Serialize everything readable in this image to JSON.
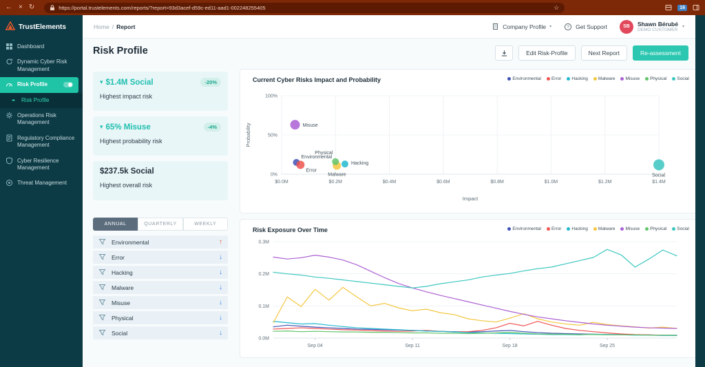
{
  "browser": {
    "url": "https://portal.trustelements.com/reports/?report=93d3acef-d59c-ed11-aad1-002248255405",
    "badge_count": "16"
  },
  "icons": {
    "back": "←",
    "close": "×",
    "refresh": "↻",
    "star": "☆",
    "caret_down": "▾",
    "chevron_down": "▾",
    "trend_up": "↑",
    "trend_down": "↓",
    "breadcrumb_separator": "/"
  },
  "brand": {
    "name": "TrustElements"
  },
  "sidebar": {
    "items": [
      {
        "icon": "dashboard",
        "label": "Dashboard"
      },
      {
        "icon": "cycle",
        "label": "Dynamic Cyber Risk Management"
      },
      {
        "icon": "gauge",
        "label": "Risk Profile",
        "active": true
      },
      {
        "icon": "dot",
        "label": "Risk Profile",
        "sub": true
      },
      {
        "icon": "gear",
        "label": "Operations Risk Management"
      },
      {
        "icon": "doc",
        "label": "Regulatory Compliance Management"
      },
      {
        "icon": "shield",
        "label": "Cyber Resilience Management"
      },
      {
        "icon": "target",
        "label": "Threat Management"
      }
    ]
  },
  "topbar": {
    "breadcrumb": {
      "home": "Home",
      "current": "Report"
    },
    "company_profile": "Company Profile",
    "get_support": "Get Support",
    "user": {
      "initials": "SB",
      "name": "Shawn Bérubé",
      "role": "DEMO CUSTOMER"
    }
  },
  "page": {
    "title": "Risk Profile",
    "buttons": {
      "edit": "Edit Risk-Profile",
      "next": "Next Report",
      "reassess": "Re-assessment"
    }
  },
  "summary_cards": [
    {
      "value": "$1.4M Social",
      "badge": "-20%",
      "caption": "Highest impact risk",
      "style": "accent",
      "caret": true
    },
    {
      "value": "65% Misuse",
      "badge": "-4%",
      "caption": "Highest probability risk",
      "style": "accent",
      "caret": true
    },
    {
      "value": "$237.5k Social",
      "caption": "Highest overall risk",
      "style": "dark",
      "caret": false
    }
  ],
  "tabs": [
    {
      "label": "ANNUAL",
      "active": true
    },
    {
      "label": "QUARTERLY",
      "active": false
    },
    {
      "label": "WEEKLY",
      "active": false
    }
  ],
  "risk_list": [
    {
      "name": "Environmental",
      "trend": "up"
    },
    {
      "name": "Error",
      "trend": "down"
    },
    {
      "name": "Hacking",
      "trend": "down"
    },
    {
      "name": "Malware",
      "trend": "down"
    },
    {
      "name": "Misuse",
      "trend": "down"
    },
    {
      "name": "Physical",
      "trend": "down"
    },
    {
      "name": "Social",
      "trend": "down"
    }
  ],
  "categories": [
    {
      "name": "Environmental",
      "color": "#3f51b5"
    },
    {
      "name": "Error",
      "color": "#ef5350"
    },
    {
      "name": "Hacking",
      "color": "#22b8cf"
    },
    {
      "name": "Malware",
      "color": "#f4c63e"
    },
    {
      "name": "Misuse",
      "color": "#ab5fd3"
    },
    {
      "name": "Physical",
      "color": "#61c46a"
    },
    {
      "name": "Social",
      "color": "#3ac6bf"
    }
  ],
  "colors": {
    "accent_teal": "#1fbfae",
    "primary_button": "#2bc7b0",
    "active_nav": "#1fc3a6",
    "sidebar_bg": "#0c3a45",
    "browser_bar": "#7d2807",
    "avatar_bg": "#e2485b",
    "trend_up": "#e0503c",
    "trend_down": "#2f7fe8",
    "tab_active_bg": "#5b6d7d",
    "badge_bg": "#d2efe9",
    "badge_text": "#18a68e"
  },
  "chart_data": [
    {
      "type": "scatter",
      "title": "Current Cyber Risks Impact and Probability",
      "xlabel": "Impact",
      "ylabel": "Probability",
      "xlim": [
        0,
        1.4
      ],
      "ylim": [
        0,
        100
      ],
      "x_tick_labels": [
        "$0.0M",
        "$0.2M",
        "$0.4M",
        "$0.6M",
        "$0.8M",
        "$1.0M",
        "$1.2M",
        "$1.4M"
      ],
      "y_tick_labels": [
        "0%",
        "50%",
        "100%"
      ],
      "legend_position": "top-right",
      "points": [
        {
          "name": "Environmental",
          "impact_m": 0.055,
          "probability_pct": 15,
          "r": 5
        },
        {
          "name": "Error",
          "impact_m": 0.07,
          "probability_pct": 12,
          "r": 6
        },
        {
          "name": "Hacking",
          "impact_m": 0.235,
          "probability_pct": 13,
          "r": 5
        },
        {
          "name": "Malware",
          "impact_m": 0.205,
          "probability_pct": 11,
          "r": 6
        },
        {
          "name": "Misuse",
          "impact_m": 0.05,
          "probability_pct": 63,
          "r": 7
        },
        {
          "name": "Physical",
          "impact_m": 0.2,
          "probability_pct": 16,
          "r": 5
        },
        {
          "name": "Social",
          "impact_m": 1.4,
          "probability_pct": 12,
          "r": 8
        }
      ]
    },
    {
      "type": "line",
      "title": "Risk Exposure Over Time",
      "xlabel": "",
      "ylabel": "",
      "ylim": [
        0,
        0.3
      ],
      "y_tick_labels": [
        "0.0M",
        "0.1M",
        "0.2M",
        "0.3M"
      ],
      "x_tick_labels": [
        "Sep 04",
        "Sep 11",
        "Sep 18",
        "Sep 25"
      ],
      "legend_position": "top-right",
      "x": [
        "Sep 01",
        "Sep 02",
        "Sep 03",
        "Sep 04",
        "Sep 05",
        "Sep 06",
        "Sep 07",
        "Sep 08",
        "Sep 09",
        "Sep 10",
        "Sep 11",
        "Sep 12",
        "Sep 13",
        "Sep 14",
        "Sep 15",
        "Sep 16",
        "Sep 17",
        "Sep 18",
        "Sep 19",
        "Sep 20",
        "Sep 21",
        "Sep 22",
        "Sep 23",
        "Sep 24",
        "Sep 25",
        "Sep 26",
        "Sep 27",
        "Sep 28",
        "Sep 29",
        "Sep 30"
      ],
      "series": [
        {
          "name": "Environmental",
          "values": [
            0.035,
            0.04,
            0.037,
            0.034,
            0.032,
            0.03,
            0.028,
            0.027,
            0.026,
            0.025,
            0.024,
            0.022,
            0.021,
            0.02,
            0.019,
            0.02,
            0.022,
            0.024,
            0.02,
            0.017,
            0.015,
            0.014,
            0.013,
            0.012,
            0.011,
            0.011,
            0.01,
            0.01,
            0.009,
            0.009
          ]
        },
        {
          "name": "Error",
          "values": [
            0.028,
            0.03,
            0.032,
            0.03,
            0.028,
            0.026,
            0.025,
            0.023,
            0.022,
            0.021,
            0.022,
            0.024,
            0.021,
            0.019,
            0.02,
            0.024,
            0.032,
            0.046,
            0.038,
            0.052,
            0.04,
            0.03,
            0.024,
            0.02,
            0.016,
            0.013,
            0.011,
            0.01,
            0.009,
            0.008
          ]
        },
        {
          "name": "Hacking",
          "values": [
            0.052,
            0.048,
            0.044,
            0.045,
            0.04,
            0.036,
            0.032,
            0.03,
            0.028,
            0.026,
            0.024,
            0.022,
            0.021,
            0.019,
            0.017,
            0.016,
            0.015,
            0.014,
            0.013,
            0.012,
            0.011,
            0.011,
            0.01,
            0.012,
            0.011,
            0.01,
            0.009,
            0.009,
            0.008,
            0.008
          ]
        },
        {
          "name": "Malware",
          "values": [
            0.048,
            0.128,
            0.098,
            0.152,
            0.118,
            0.158,
            0.128,
            0.1,
            0.108,
            0.094,
            0.085,
            0.09,
            0.079,
            0.073,
            0.06,
            0.054,
            0.05,
            0.062,
            0.076,
            0.06,
            0.05,
            0.044,
            0.04,
            0.049,
            0.042,
            0.038,
            0.035,
            0.031,
            0.034,
            0.03
          ]
        },
        {
          "name": "Misuse",
          "values": [
            0.252,
            0.246,
            0.25,
            0.258,
            0.252,
            0.243,
            0.228,
            0.208,
            0.188,
            0.17,
            0.156,
            0.144,
            0.133,
            0.123,
            0.113,
            0.103,
            0.093,
            0.083,
            0.074,
            0.066,
            0.06,
            0.054,
            0.049,
            0.044,
            0.04,
            0.037,
            0.034,
            0.032,
            0.031,
            0.03
          ]
        },
        {
          "name": "Physical",
          "values": [
            0.021,
            0.022,
            0.02,
            0.021,
            0.02,
            0.019,
            0.019,
            0.018,
            0.018,
            0.017,
            0.016,
            0.016,
            0.015,
            0.015,
            0.014,
            0.015,
            0.016,
            0.018,
            0.015,
            0.013,
            0.012,
            0.012,
            0.011,
            0.011,
            0.01,
            0.01,
            0.01,
            0.009,
            0.009,
            0.009
          ]
        },
        {
          "name": "Social",
          "values": [
            0.205,
            0.2,
            0.196,
            0.19,
            0.186,
            0.181,
            0.176,
            0.171,
            0.166,
            0.161,
            0.156,
            0.161,
            0.169,
            0.175,
            0.181,
            0.19,
            0.196,
            0.201,
            0.209,
            0.216,
            0.221,
            0.231,
            0.241,
            0.251,
            0.276,
            0.259,
            0.221,
            0.246,
            0.274,
            0.256
          ]
        }
      ]
    }
  ]
}
